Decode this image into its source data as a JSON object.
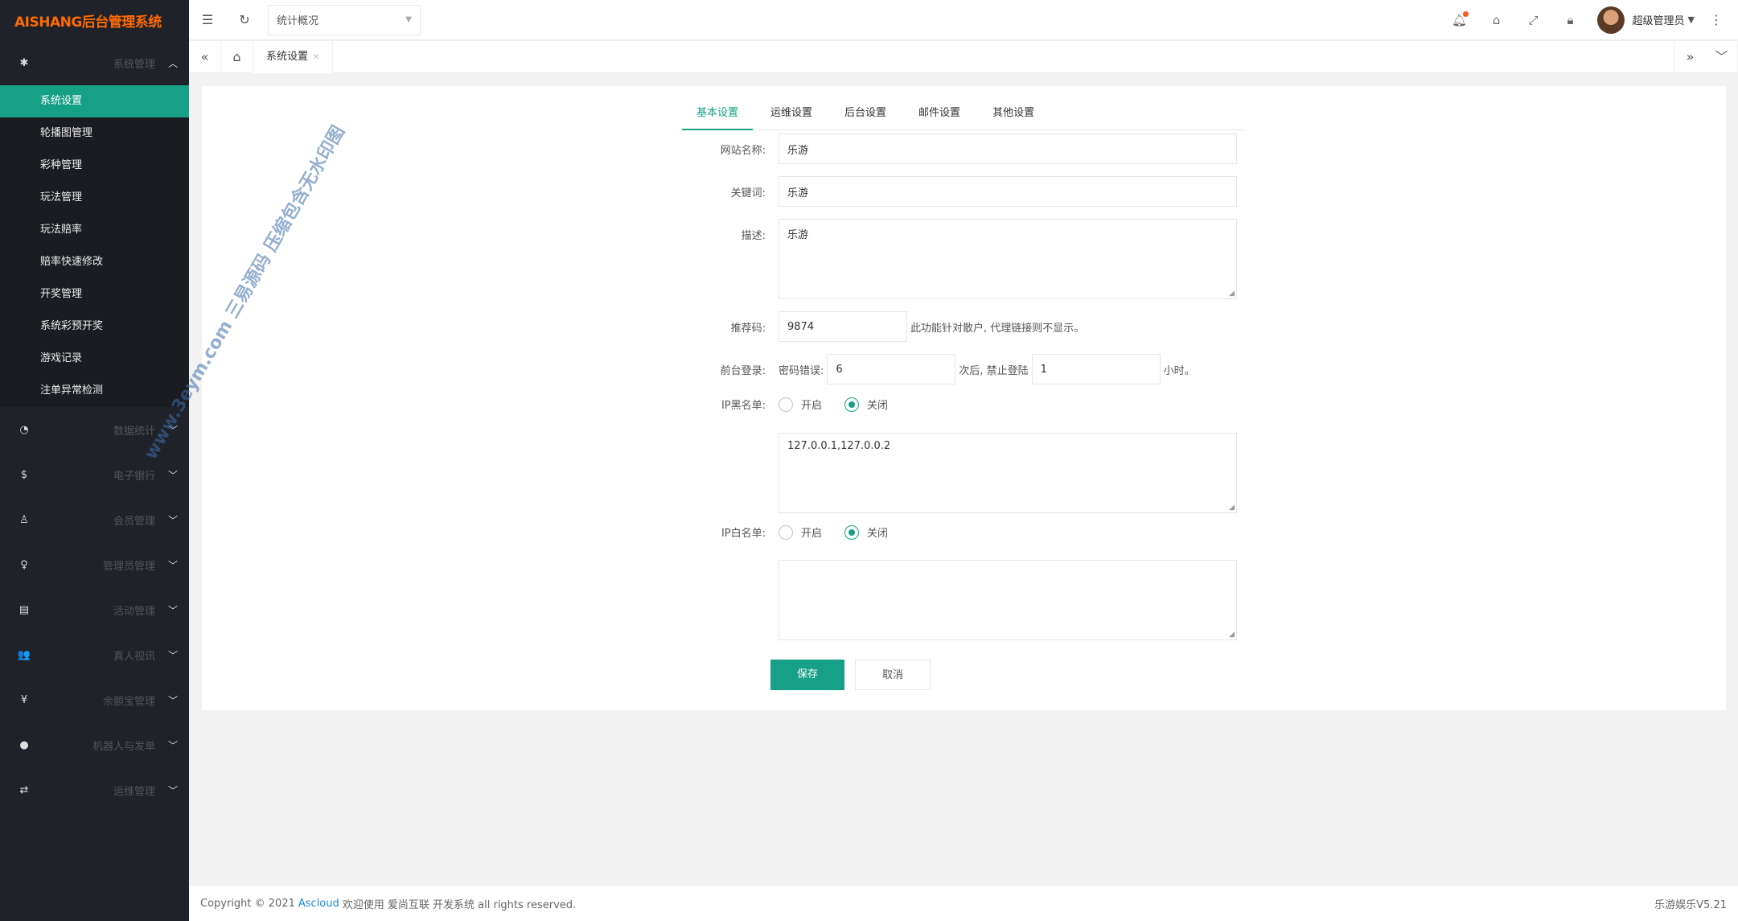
{
  "app": {
    "logo_text": "AISHANG后台管理系统"
  },
  "sidebar": {
    "open_group": {
      "label": "系统管理",
      "icon": "gear-icon"
    },
    "sub_items": [
      {
        "label": "系统设置",
        "active": true
      },
      {
        "label": "轮播图管理"
      },
      {
        "label": "彩种管理"
      },
      {
        "label": "玩法管理"
      },
      {
        "label": "玩法赔率"
      },
      {
        "label": "赔率快速修改"
      },
      {
        "label": "开奖管理"
      },
      {
        "label": "系统彩预开奖"
      },
      {
        "label": "游戏记录"
      },
      {
        "label": "注单异常检测"
      }
    ],
    "groups": [
      {
        "label": "数据统计",
        "icon": "dashboard-icon"
      },
      {
        "label": "电子银行",
        "icon": "coin-icon"
      },
      {
        "label": "会员管理",
        "icon": "member-icon"
      },
      {
        "label": "管理员管理",
        "icon": "user-icon"
      },
      {
        "label": "活动管理",
        "icon": "calendar-icon"
      },
      {
        "label": "真人视讯",
        "icon": "users-icon"
      },
      {
        "label": "余额宝管理",
        "icon": "yen-icon"
      },
      {
        "label": "机器人与发单",
        "icon": "person-icon"
      },
      {
        "label": "运维管理",
        "icon": "shuffle-icon"
      }
    ]
  },
  "topbar": {
    "select_value": "统计概况",
    "username": "超级管理员",
    "accent": "#16a085",
    "notify_dot_color": "#ff5722"
  },
  "tabbar": {
    "current_tab": "系统设置"
  },
  "form": {
    "tabs": [
      "基本设置",
      "运维设置",
      "后台设置",
      "邮件设置",
      "其他设置"
    ],
    "site_name_label": "网站名称:",
    "site_name_value": "乐游",
    "keywords_label": "关键词:",
    "keywords_value": "乐游",
    "desc_label": "描述:",
    "desc_value": "乐游",
    "ref_label": "推荐码:",
    "ref_value": "9874",
    "ref_hint": "此功能针对散户, 代理链接则不显示。",
    "login_label": "前台登录:",
    "login_pwd_label": "密码错误:",
    "login_pwd_value": "6",
    "login_mid": "次后, 禁止登陆",
    "login_hours_value": "1",
    "login_tail": "小时。",
    "ip_black_label": "IP黑名单:",
    "ip_black_value": "127.0.0.1,127.0.0.2",
    "ip_white_label": "IP白名单:",
    "ip_white_value": "",
    "radio_on_label": "开启",
    "radio_off_label": "关闭",
    "save_label": "保存",
    "cancel_label": "取消"
  },
  "footer": {
    "copyright_prefix": "Copyright © 2021",
    "link_text": "Ascloud",
    "copyright_suffix": "欢迎使用 爱尚互联 开发系统 all rights reserved.",
    "version": "乐游娱乐V5.21"
  },
  "watermark": {
    "text": "www.3eym.com 三易源码 压缩包含无水印图"
  }
}
